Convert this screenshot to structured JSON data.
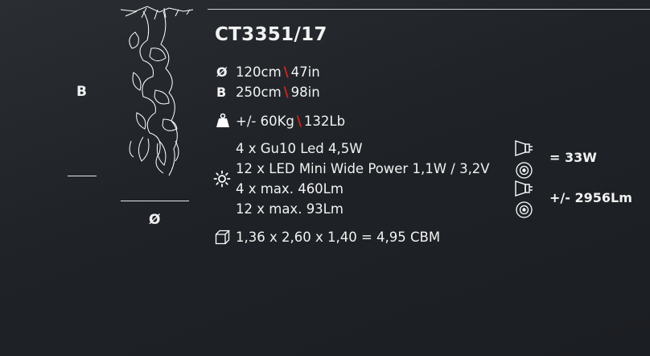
{
  "product": {
    "code": "CT3351/17"
  },
  "dimensions": {
    "diameter_symbol": "Ø",
    "diameter_cm": "120cm",
    "diameter_in": "47in",
    "height_symbol": "B",
    "height_cm": "250cm",
    "height_in": "98in",
    "separator": "\\"
  },
  "weight": {
    "kg": "+/- 60Kg",
    "lb": "132Lb"
  },
  "lighting": {
    "bulbs": [
      "4 x Gu10 Led 4,5W",
      "12 x LED Mini Wide Power 1,1W / 3,2V",
      "4 x max. 460Lm",
      "12 x max. 93Lm"
    ],
    "total_power": "= 33W",
    "total_lumen": "+/- 2956Lm"
  },
  "packaging": {
    "volume": "1,36 x 2,60 x 1,40 = 4,95 CBM"
  },
  "diagram": {
    "height_label": "B",
    "diameter_label": "Ø"
  },
  "icons": [
    "weight-icon",
    "sun-icon",
    "spotlight-gu10-icon",
    "led-disc-icon",
    "box-icon"
  ],
  "colors": {
    "background": "#1f2327",
    "separator": "#e0201c",
    "text": "#f2f2f2"
  }
}
